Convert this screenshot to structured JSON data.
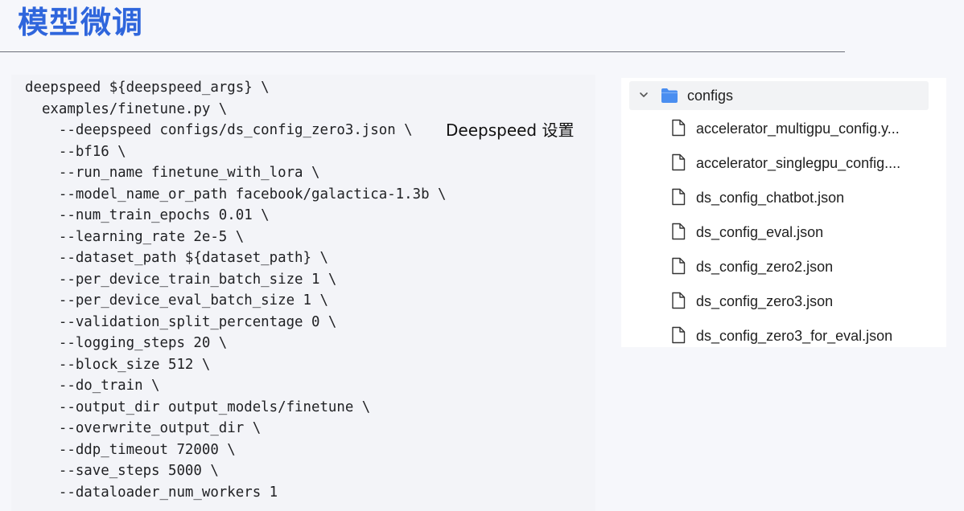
{
  "slide": {
    "title": "模型微调"
  },
  "code": {
    "lines": [
      "deepspeed ${deepspeed_args} \\",
      "  examples/finetune.py \\",
      "    --deepspeed configs/ds_config_zero3.json \\",
      "    --bf16 \\",
      "    --run_name finetune_with_lora \\",
      "    --model_name_or_path facebook/galactica-1.3b \\",
      "    --num_train_epochs 0.01 \\",
      "    --learning_rate 2e-5 \\",
      "    --dataset_path ${dataset_path} \\",
      "    --per_device_train_batch_size 1 \\",
      "    --per_device_eval_batch_size 1 \\",
      "    --validation_split_percentage 0 \\",
      "    --logging_steps 20 \\",
      "    --block_size 512 \\",
      "    --do_train \\",
      "    --output_dir output_models/finetune \\",
      "    --overwrite_output_dir \\",
      "    --ddp_timeout 72000 \\",
      "    --save_steps 5000 \\",
      "    --dataloader_num_workers 1"
    ],
    "annotation": "Deepspeed 设置"
  },
  "explorer": {
    "folder": {
      "label": "configs",
      "expanded": true,
      "icon": "folder-icon",
      "color": "#4a8ef0"
    },
    "files": [
      "accelerator_multigpu_config.y...",
      "accelerator_singlegpu_config....",
      "ds_config_chatbot.json",
      "ds_config_eval.json",
      "ds_config_zero2.json",
      "ds_config_zero3.json",
      "ds_config_zero3_for_eval.json"
    ],
    "file_icon": "file-icon"
  },
  "colors": {
    "title": "#2f66dc",
    "background": "#f6f7fb",
    "code_panel": "#f3f4f8",
    "text": "#202124"
  }
}
